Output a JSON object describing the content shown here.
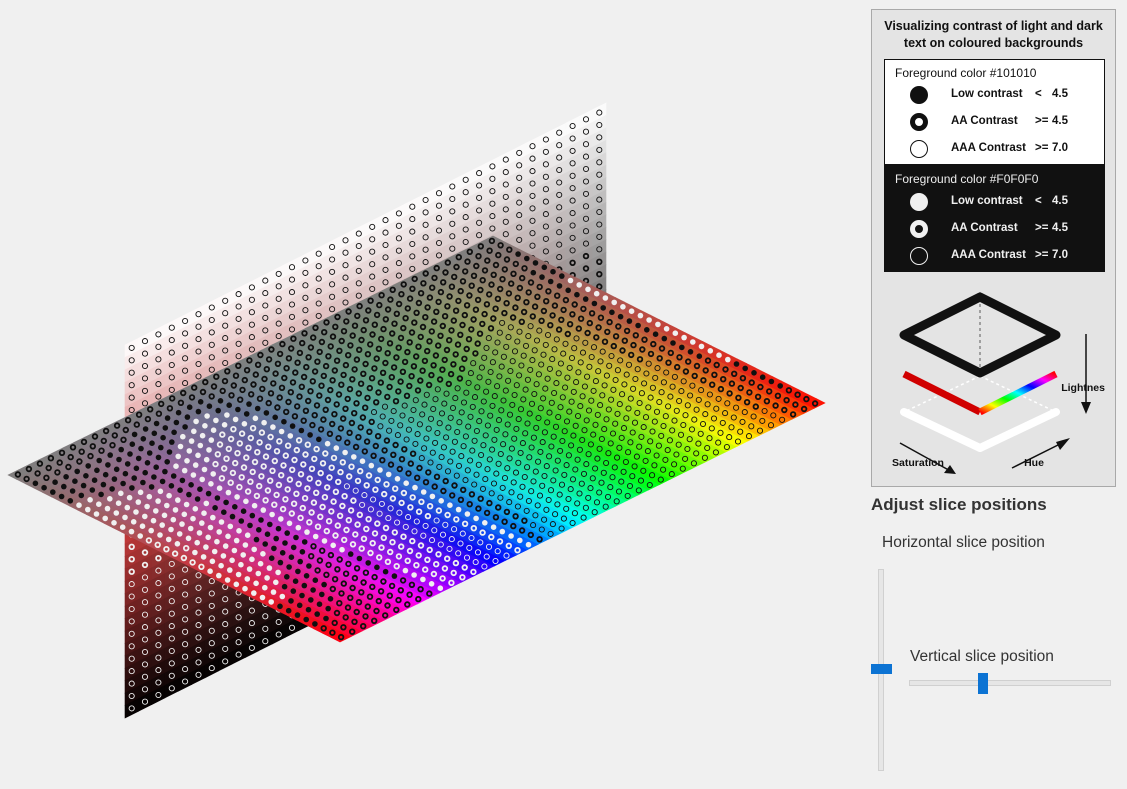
{
  "legend": {
    "title_line1": "Visualizing contrast of light and dark",
    "title_line2": "text on coloured backgrounds",
    "light": {
      "title": "Foreground color #101010",
      "rows": [
        {
          "label": "Low contrast",
          "op": "<",
          "value": "4.5"
        },
        {
          "label": "AA Contrast",
          "op": ">=",
          "value": "4.5"
        },
        {
          "label": "AAA Contrast",
          "op": ">=",
          "value": "7.0"
        }
      ]
    },
    "dark": {
      "title": "Foreground color #F0F0F0",
      "rows": [
        {
          "label": "Low contrast",
          "op": "<",
          "value": "4.5"
        },
        {
          "label": "AA Contrast",
          "op": ">=",
          "value": "4.5"
        },
        {
          "label": "AAA Contrast",
          "op": ">=",
          "value": "7.0"
        }
      ]
    },
    "cube": {
      "lightness_label": "Lightness",
      "saturation_label": "Saturation",
      "hue_label": "Hue"
    }
  },
  "controls": {
    "title": "Adjust slice positions",
    "horizontal_label": "Horizontal slice position",
    "vertical_label": "Vertical slice position",
    "horizontal_value": 0.49,
    "vertical_value": 0.38
  },
  "colors": {
    "dark_fg": "#101010",
    "light_fg": "#F0F0F0",
    "accent": "#0c73d3"
  }
}
